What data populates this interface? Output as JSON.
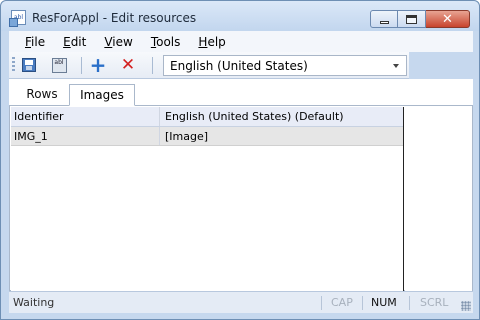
{
  "window": {
    "title": "ResForAppl - Edit resources",
    "app_icon_text": "abl"
  },
  "menu": {
    "items": [
      {
        "label": "File",
        "accel": "F",
        "rest": "ile"
      },
      {
        "label": "Edit",
        "accel": "E",
        "rest": "dit"
      },
      {
        "label": "View",
        "accel": "V",
        "rest": "iew"
      },
      {
        "label": "Tools",
        "accel": "T",
        "rest": "ools"
      },
      {
        "label": "Help",
        "accel": "H",
        "rest": "elp"
      }
    ]
  },
  "toolbar": {
    "save_icon": "save-icon",
    "saveas_icon_text": "abl",
    "add_icon": "add-icon",
    "delete_icon": "delete-icon",
    "language_value": "English (United States)"
  },
  "tabs": [
    {
      "label": "Rows",
      "selected": false
    },
    {
      "label": "Images",
      "selected": true
    }
  ],
  "grid": {
    "columns": [
      "Identifier",
      "English (United States) (Default)"
    ],
    "rows": [
      [
        "IMG_1",
        "[Image]"
      ]
    ]
  },
  "status": {
    "text": "Waiting",
    "cap": "CAP",
    "num": "NUM",
    "scrl": "SCRL"
  },
  "colors": {
    "close_button": "#c8442d",
    "add_icon": "#2a6fc9",
    "delete_icon": "#d32020"
  }
}
